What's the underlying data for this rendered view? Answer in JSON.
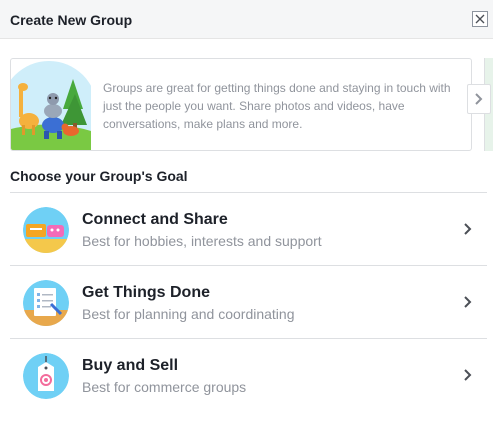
{
  "dialog": {
    "title": "Create New Group",
    "close_icon": "close-icon"
  },
  "intro": {
    "text": "Groups are great for getting things done and staying in touch with just the people you want. Share photos and videos, have conversations, make plans and more.",
    "next_icon": "chevron-right-icon"
  },
  "goals": {
    "heading": "Choose your Group's Goal",
    "items": [
      {
        "title": "Connect and Share",
        "subtitle": "Best for hobbies, interests and support",
        "icon": "connect-share-icon"
      },
      {
        "title": "Get Things Done",
        "subtitle": "Best for planning and coordinating",
        "icon": "checklist-icon"
      },
      {
        "title": "Buy and Sell",
        "subtitle": "Best for commerce groups",
        "icon": "price-tag-icon"
      }
    ]
  },
  "colors": {
    "title_text": "#1d2129",
    "secondary_text": "#90949c",
    "header_bg": "#f5f6f7",
    "icon_bg_blue": "#6fd0f5"
  }
}
